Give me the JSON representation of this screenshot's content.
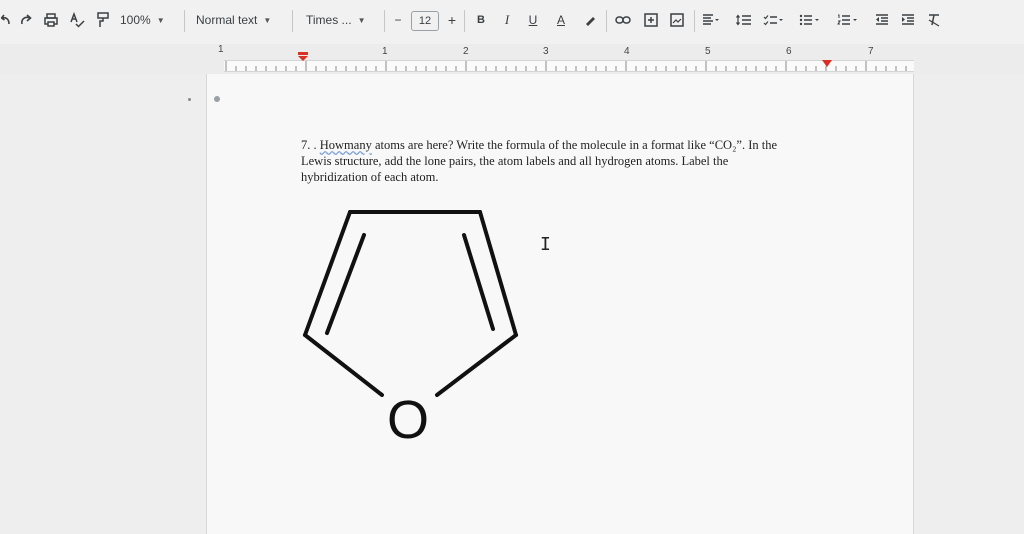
{
  "toolbar": {
    "zoom": "100%",
    "style": "Normal text",
    "font": "Times ...",
    "font_size": "12",
    "minus": "−",
    "plus": "+",
    "bold": "B",
    "italic": "I",
    "underline": "U",
    "text_color": "A"
  },
  "ruler": {
    "numbers": [
      "1",
      "1",
      "2",
      "3",
      "4",
      "5",
      "6",
      "7"
    ]
  },
  "document": {
    "question_lines": [
      "7. .",
      "atoms are here? Write the formula of the molecule in a format like “CO₂”. In the",
      "Lewis structure, add the lone pairs, the atom labels and all hydrogen atoms. Label the",
      "hybridization of each atom."
    ],
    "underlined_word": "Howmany",
    "atom_label": "O"
  },
  "colors": {
    "toolbar_bg": "#f1f1f1",
    "page_bg": "#f8f8f8",
    "ruler_marker": "#d93025",
    "spell_underline": "#7a9fd6"
  }
}
